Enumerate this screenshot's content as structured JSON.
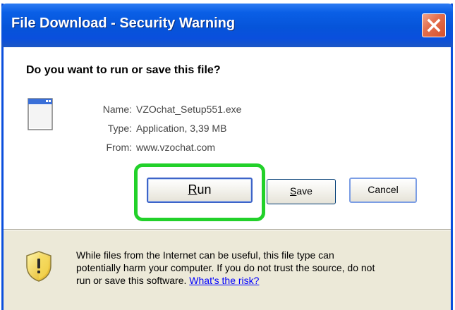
{
  "window": {
    "title": "File Download - Security Warning",
    "caption_fragment": ""
  },
  "dialog": {
    "question": "Do you want to run or save this file?",
    "file": {
      "name_label": "Name:",
      "name_value": "VZOchat_Setup551.exe",
      "type_label": "Type:",
      "type_value": "Application, 3,39 MB",
      "from_label": "From:",
      "from_value": "www.vzochat.com"
    },
    "buttons": {
      "run_label": "Run",
      "save_label": "Save",
      "cancel_label": "Cancel"
    },
    "warning": {
      "line1": "While files from the Internet can be useful, this file type can",
      "line2": "potentially harm your computer. If you do not trust the source, do not",
      "line3_prefix": "run or save this software. ",
      "risk_link": "What's the risk?"
    }
  },
  "colors": {
    "titlebar": "#0a4fdd",
    "highlight": "#22d12a",
    "link": "#0000ff"
  },
  "icons": [
    "close-icon",
    "application-window-icon",
    "security-shield-icon"
  ]
}
